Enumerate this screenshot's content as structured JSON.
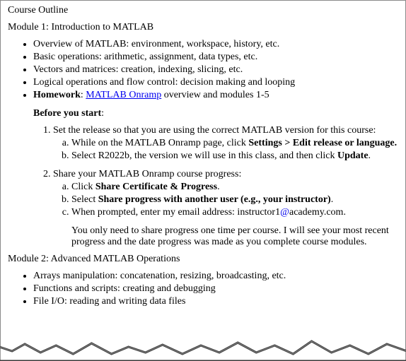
{
  "title": "Course Outline",
  "module1": {
    "heading": "Module 1: Introduction to MATLAB",
    "bullets": {
      "b1": "Overview of MATLAB: environment, workspace, history, etc.",
      "b2": "Basic operations: arithmetic, assignment, data types, etc.",
      "b3": "Vectors and matrices: creation, indexing, slicing, etc.",
      "b4": "Logical operations and flow control: decision making and looping"
    },
    "hw_label": "Homework",
    "hw_sep": ": ",
    "hw_link": "MATLAB Onramp",
    "hw_rest": " overview and modules 1-5",
    "before_label": "Before you start",
    "before_colon": ":",
    "step1": {
      "text": "Set the release so that you are using the correct MATLAB version for this course:",
      "a_pre": "While on the MATLAB Onramp page, click ",
      "a_bold": "Settings > Edit release or language.",
      "b_pre": "Select R2022b, the version we will use in this class, and then click ",
      "b_bold": "Update",
      "b_post": "."
    },
    "step2": {
      "text": "Share your MATLAB Onramp course progress:",
      "a_pre": "Click ",
      "a_bold": "Share Certificate & Progress",
      "a_post": ".",
      "b_pre": "Select ",
      "b_bold": "Share progress with another user (e.g., your instructor)",
      "b_post": ".",
      "c_pre": "When prompted, enter my email address: instructor1",
      "c_at": "@",
      "c_post": "academy.com."
    },
    "note": "You only need to share progress one time per course. I will see your most recent progress and the date progress was made as you complete course modules."
  },
  "module2": {
    "heading": "Module 2: Advanced MATLAB Operations",
    "bullets": {
      "b1": "Arrays manipulation: concatenation, resizing, broadcasting, etc.",
      "b2": "Functions and scripts: creating and debugging",
      "b3": "File I/O: reading and writing data files"
    }
  }
}
